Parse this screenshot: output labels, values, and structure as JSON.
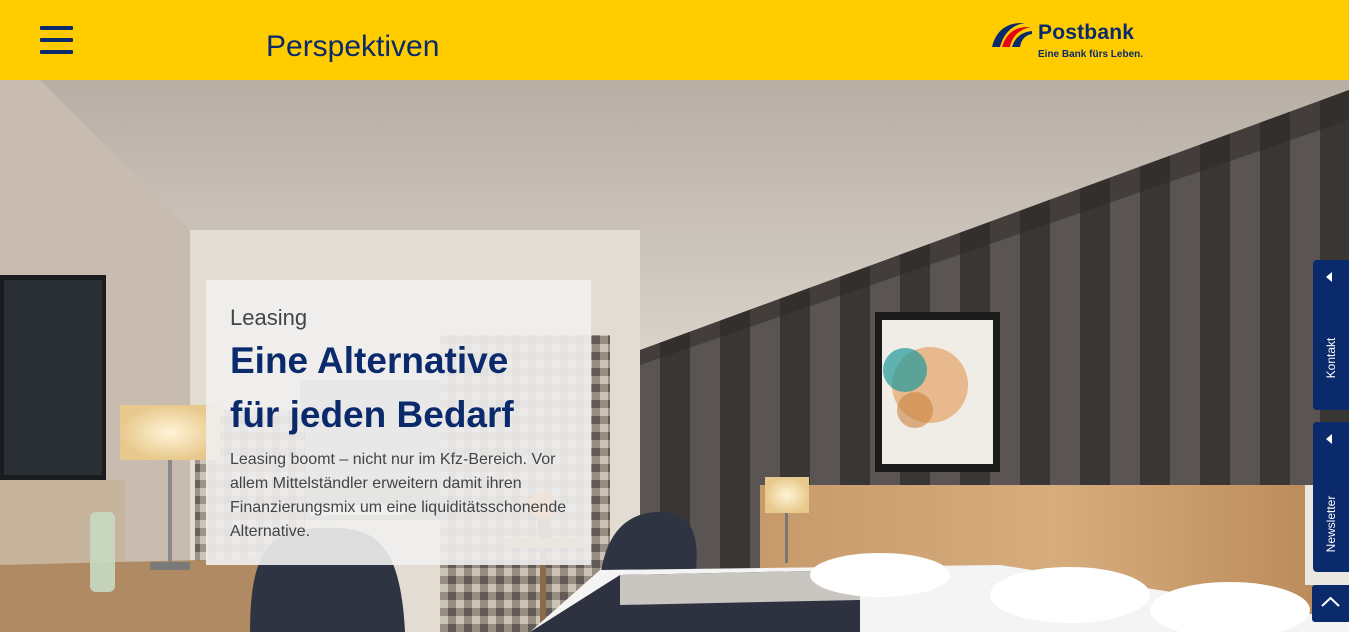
{
  "header": {
    "menu_icon": "hamburger-menu-icon",
    "title": "Perspektiven",
    "logo": {
      "name": "Postbank",
      "claim": "Eine Bank fürs Leben.",
      "colors": {
        "primary": "#0a2a6b",
        "accent": "#e30613",
        "background": "#ffcc00"
      }
    }
  },
  "hero": {
    "image": "hotel-room-photo",
    "teaser": {
      "kicker": "Leasing",
      "headline_line1": "Eine Alternative",
      "headline_line2": "für jeden Bedarf",
      "text": "Leasing boomt – nicht nur im Kfz-Bereich. Vor allem Mittelständler erweitern damit ihren Finanzierungsmix um eine liquiditätsschonende Alternative."
    }
  },
  "side_tabs": [
    {
      "label": "Kontakt",
      "icon": "chevron-left-icon"
    },
    {
      "label": "Newsletter",
      "icon": "chevron-left-icon"
    }
  ],
  "scroll_top": {
    "icon": "chevron-up-icon"
  }
}
